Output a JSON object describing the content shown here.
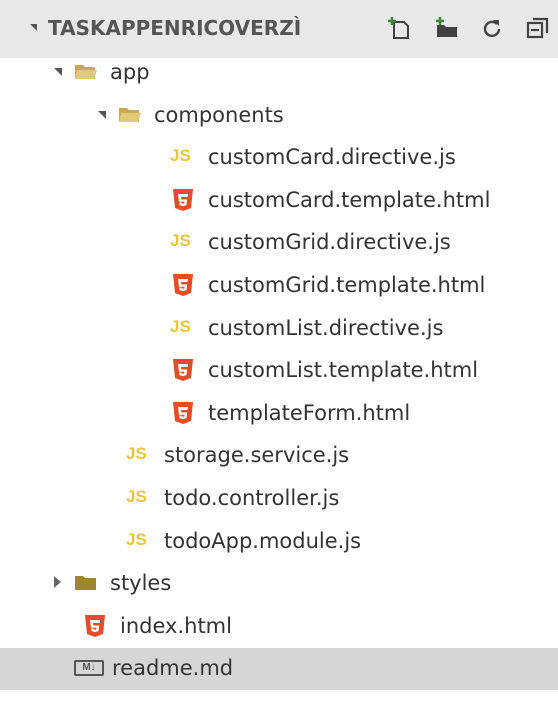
{
  "explorer": {
    "title": "TASKAPPENRICOVERZÌ",
    "actions": [
      {
        "name": "new-file-icon"
      },
      {
        "name": "new-folder-icon"
      },
      {
        "name": "refresh-icon"
      },
      {
        "name": "collapse-all-icon"
      }
    ],
    "tree": [
      {
        "label": "app",
        "type": "folder",
        "expanded": true,
        "depth": 1
      },
      {
        "label": "components",
        "type": "folder",
        "expanded": true,
        "depth": 2
      },
      {
        "label": "customCard.directive.js",
        "type": "js",
        "depth": 3
      },
      {
        "label": "customCard.template.html",
        "type": "html",
        "depth": 3
      },
      {
        "label": "customGrid.directive.js",
        "type": "js",
        "depth": 3
      },
      {
        "label": "customGrid.template.html",
        "type": "html",
        "depth": 3
      },
      {
        "label": "customList.directive.js",
        "type": "js",
        "depth": 3
      },
      {
        "label": "customList.template.html",
        "type": "html",
        "depth": 3
      },
      {
        "label": "templateForm.html",
        "type": "html",
        "depth": 3
      },
      {
        "label": "storage.service.js",
        "type": "js",
        "depth": 2
      },
      {
        "label": "todo.controller.js",
        "type": "js",
        "depth": 2
      },
      {
        "label": "todoApp.module.js",
        "type": "js",
        "depth": 2
      },
      {
        "label": "styles",
        "type": "folder",
        "expanded": false,
        "depth": 1
      },
      {
        "label": "index.html",
        "type": "html",
        "depth": 1
      },
      {
        "label": "readme.md",
        "type": "md",
        "depth": 1,
        "selected": true
      }
    ],
    "badges": {
      "js": "JS",
      "md": "M↓"
    },
    "colors": {
      "header_bg": "#e8e8e8",
      "selected_bg": "#d6d6d6",
      "js_badge": "#e8c53a",
      "html_badge": "#e44d26",
      "folder": "#c9a94b"
    }
  }
}
